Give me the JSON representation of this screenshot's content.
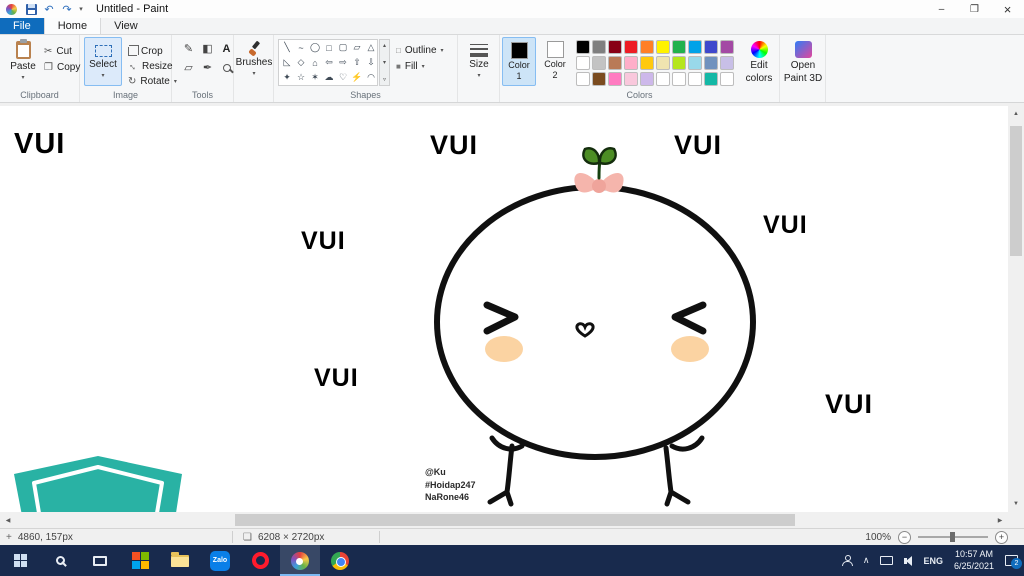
{
  "titlebar": {
    "title": "Untitled - Paint"
  },
  "tabs": {
    "file": "File",
    "home": "Home",
    "view": "View"
  },
  "icons": {
    "undo": "↶",
    "redo": "↷",
    "dropdown": "▾",
    "minimize": "–",
    "restore": "❐",
    "close": "×",
    "cut": "✂",
    "copy": "❐",
    "rotate": "↻",
    "resize": "↔",
    "pencil": "✎",
    "fill_tool": "◧",
    "text_tool": "A",
    "eraser": "▱",
    "picker": "✒",
    "outline": "□",
    "fill_swatch": "■",
    "crosshair": "+",
    "image_size": "❏",
    "scroll_up": "▲",
    "scroll_down": "▼",
    "scroll_left": "◀",
    "scroll_right": "▶",
    "gallery_up": "▴",
    "gallery_down": "▾",
    "gallery_more": "▿",
    "zoom_out": "−",
    "zoom_in": "+",
    "hidden_icons": "∧"
  },
  "ribbon": {
    "clipboard": {
      "label": "Clipboard",
      "paste": "Paste",
      "cut": "Cut",
      "copy": "Copy"
    },
    "image": {
      "label": "Image",
      "select": "Select",
      "crop": "Crop",
      "resize": "Resize",
      "rotate": "Rotate"
    },
    "tools": {
      "label": "Tools"
    },
    "brushes": {
      "label": "Brushes"
    },
    "shapes": {
      "label": "Shapes",
      "outline": "Outline",
      "fill": "Fill",
      "gallery": [
        "╲",
        "~",
        "◯",
        "□",
        "▢",
        "▱",
        "△",
        "◺",
        "◇",
        "⌂",
        "⇦",
        "⇨",
        "⇧",
        "⇩",
        "✦",
        "☆",
        "✶",
        "☁",
        "♡",
        "⚡",
        "◠"
      ]
    },
    "size": {
      "label": "Size"
    },
    "colors": {
      "label": "Colors",
      "color1_title": "Color",
      "color1_num": "1",
      "color2_title": "Color",
      "color2_num": "2",
      "edit_line1": "Edit",
      "edit_line2": "colors",
      "color1_value": "#000000",
      "color2_value": "#ffffff",
      "palette": [
        "#000000",
        "#7f7f7f",
        "#880015",
        "#ed1c24",
        "#ff7f27",
        "#fff200",
        "#22b14c",
        "#00a2e8",
        "#3f48cc",
        "#a349a4",
        "#ffffff",
        "#c3c3c3",
        "#b97a57",
        "#ffaec9",
        "#ffc90e",
        "#efe4b0",
        "#b5e61d",
        "#99d9ea",
        "#7092be",
        "#c8bfe7",
        "#ffffff",
        "#7a4b1f",
        "#ff7bc1",
        "#f9c8dc",
        "#cdb8ea",
        "#ffffff",
        "#ffffff",
        "#ffffff",
        "#14b8a6",
        "#ffffff"
      ]
    },
    "paint3d": {
      "line1": "Open",
      "line2": "Paint 3D"
    }
  },
  "canvas": {
    "vui_labels": [
      "VUI",
      "VUI",
      "VUI",
      "VUI",
      "VUI",
      "VUI",
      "VUI"
    ],
    "signature": {
      "line1": "@Ku",
      "line2": "#Hoidap247",
      "line3": "NaRone46"
    },
    "colors": {
      "shield": "#29b2a4",
      "blush": "#fbd3a2",
      "bow": "#f5b5ac",
      "leaf": "#4c8d24",
      "outline": "#101010"
    }
  },
  "statusbar": {
    "cursor_position": "4860, 157px",
    "image_size": "6208 × 2720px",
    "zoom": "100%"
  },
  "taskbar": {
    "zalo": "Zalo",
    "language": "ENG",
    "time": "10:57 AM",
    "date": "6/25/2021",
    "notification_count": "2"
  }
}
